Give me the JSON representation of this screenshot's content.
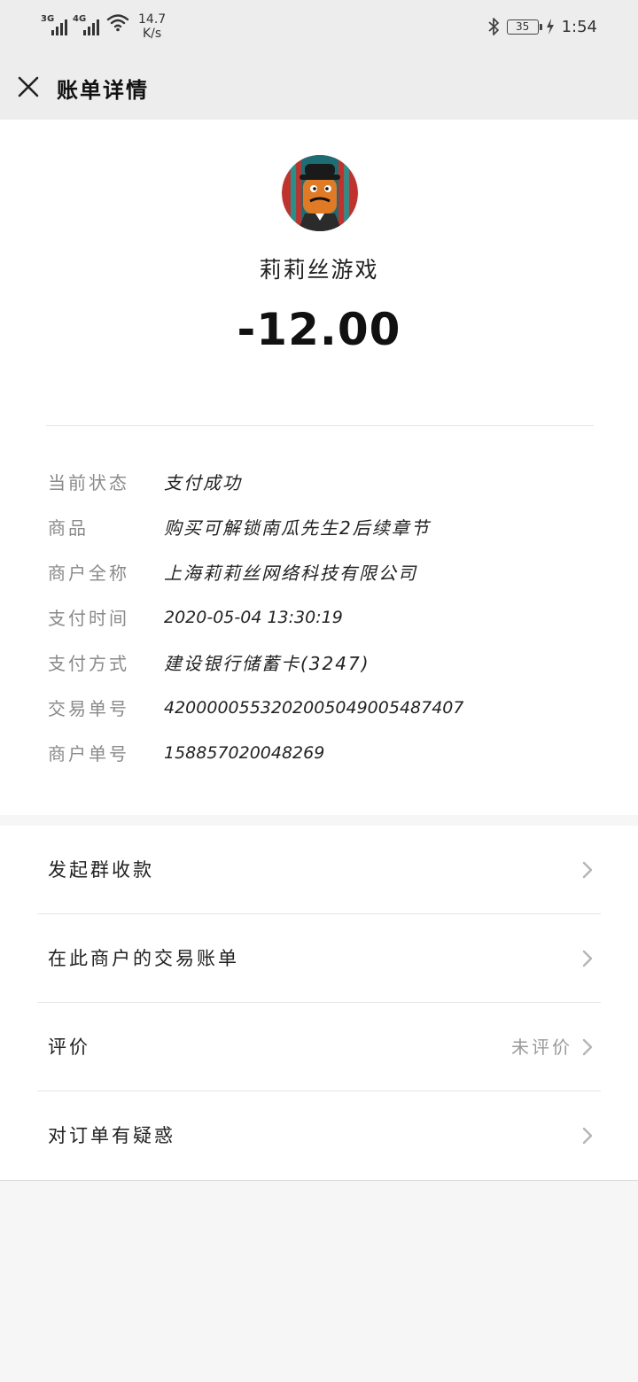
{
  "statusbar": {
    "net1": "3G",
    "net2": "4G",
    "speed_value": "14.7",
    "speed_unit": "K/s",
    "battery": "35",
    "time": "1:54"
  },
  "header": {
    "title": "账单详情"
  },
  "summary": {
    "merchant": "莉莉丝游戏",
    "amount": "-12.00"
  },
  "details": [
    {
      "label": "当前状态",
      "value": "支付成功"
    },
    {
      "label": "商品",
      "value": "购买可解锁南瓜先生2后续章节"
    },
    {
      "label": "商户全称",
      "value": "上海莉莉丝网络科技有限公司"
    },
    {
      "label": "支付时间",
      "value": "2020-05-04 13:30:19"
    },
    {
      "label": "支付方式",
      "value": "建设银行储蓄卡(3247)"
    },
    {
      "label": "交易单号",
      "value": "4200000553202005049005487407"
    },
    {
      "label": "商户单号",
      "value": "158857020048269"
    }
  ],
  "actions": [
    {
      "label": "发起群收款",
      "hint": ""
    },
    {
      "label": "在此商户的交易账单",
      "hint": ""
    },
    {
      "label": "评价",
      "hint": "未评价"
    },
    {
      "label": "对订单有疑惑",
      "hint": ""
    }
  ]
}
